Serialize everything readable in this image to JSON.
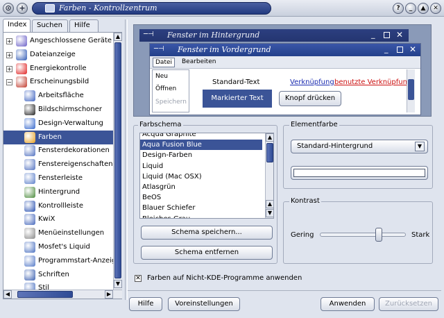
{
  "window": {
    "title": "Farben - Kontrollzentrum",
    "help_btn": "?",
    "minimize": "_",
    "maximize": "▲",
    "close": "✕"
  },
  "tabs": [
    {
      "label": "Index"
    },
    {
      "label": "Suchen"
    },
    {
      "label": "Hilfe"
    }
  ],
  "tree": [
    {
      "label": "Angeschlossene Geräte",
      "level": 0,
      "color": "#6a5fc7"
    },
    {
      "label": "Dateianzeige",
      "level": 0,
      "color": "#2f59b5"
    },
    {
      "label": "Energiekontrolle",
      "level": 0,
      "color": "#e02020"
    },
    {
      "label": "Erscheinungsbild",
      "level": 0,
      "color": "#c0392b"
    },
    {
      "label": "Arbeitsfläche",
      "level": 1,
      "color": "#3d62c0"
    },
    {
      "label": "Bildschirmschoner",
      "level": 1,
      "color": "#222222"
    },
    {
      "label": "Design-Verwaltung",
      "level": 1,
      "color": "#3366cc"
    },
    {
      "label": "Farben",
      "level": 1,
      "color": "#e8a020"
    },
    {
      "label": "Fensterdekorationen",
      "level": 1,
      "color": "#5070c0"
    },
    {
      "label": "Fenstereigenschaften",
      "level": 1,
      "color": "#5070c0"
    },
    {
      "label": "Fensterleiste",
      "level": 1,
      "color": "#5a7ec9"
    },
    {
      "label": "Hintergrund",
      "level": 1,
      "color": "#4a8a3a"
    },
    {
      "label": "Kontrollleiste",
      "level": 1,
      "color": "#2850b0"
    },
    {
      "label": "KwiX",
      "level": 1,
      "color": "#4466bb"
    },
    {
      "label": "Menüeinstellungen",
      "level": 1,
      "color": "#888888"
    },
    {
      "label": "Mosfet's Liquid",
      "level": 1,
      "color": "#4a70c0"
    },
    {
      "label": "Programmstart-Anzeig",
      "level": 1,
      "color": "#557ac8"
    },
    {
      "label": "Schriften",
      "level": 1,
      "color": "#3a5fb0"
    },
    {
      "label": "Stil",
      "level": 1,
      "color": "#4a70c0"
    }
  ],
  "preview": {
    "inactive_title": "Fenster im Hintergrund",
    "active_title": "Fenster im Vordergrund",
    "menu_datei": "Datei",
    "menu_bearbeiten": "Bearbeiten",
    "menu_items": [
      "Neu",
      "Öffnen",
      "Speichern"
    ],
    "standard_text": "Standard-Text",
    "link": "Verknüpfung",
    "visited_link": "benutzte Verknüpfung",
    "selected_text": "Markierter Text",
    "button": "Knopf drücken"
  },
  "farbschema": {
    "title": "Farbschema",
    "items": [
      "Acqua Graphite",
      "Aqua Fusion Blue",
      "Design-Farben",
      "Liquid",
      "Liquid (Mac OSX)",
      "Atlasgrün",
      "BeOS",
      "Blauer Schiefer",
      "Bleiches Grau"
    ],
    "selected": 1,
    "save_btn": "Schema speichern...",
    "remove_btn": "Schema entfernen"
  },
  "elementfarbe": {
    "title": "Elementfarbe",
    "selected": "Standard-Hintergrund"
  },
  "kontrast": {
    "title": "Kontrast",
    "low": "Gering",
    "high": "Stark",
    "value": 0.7
  },
  "checkbox_label": "Farben auf Nicht-KDE-Programme anwenden",
  "footer": {
    "help": "Hilfe",
    "defaults": "Voreinstellungen",
    "apply": "Anwenden",
    "reset": "Zurücksetzen"
  },
  "colors": {
    "accent": "#3b5497",
    "link": "#1a2bb0",
    "visited": "#cc1111"
  }
}
